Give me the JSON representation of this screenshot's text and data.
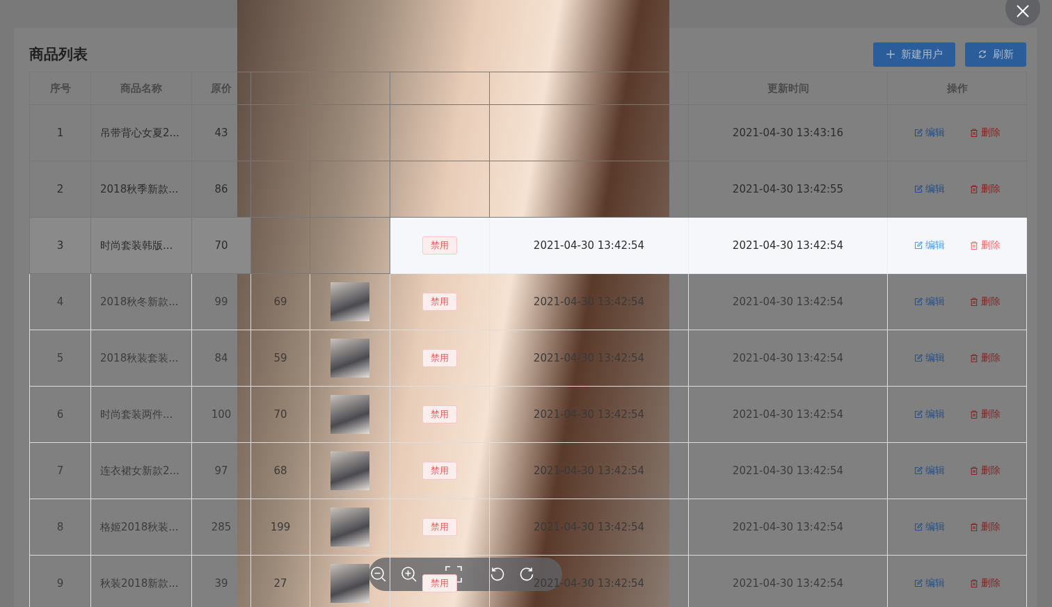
{
  "page": {
    "title": "商品列表",
    "buttons": [
      {
        "kind": "add",
        "label": "新建用户"
      },
      {
        "kind": "refresh",
        "label": "刷新"
      }
    ]
  },
  "table": {
    "columns": [
      "序号",
      "商品名称",
      "原价",
      null,
      null,
      null,
      null,
      "更新时间",
      "操作"
    ],
    "rows": [
      {
        "hovered": false,
        "dimmed": false,
        "index": "1",
        "name": "吊带背心女夏2...",
        "price": "43",
        "current_price": null,
        "thumbnail": false,
        "status": null,
        "created": null,
        "updated": "2021-04-30 13:43:16",
        "actions": [
          {
            "kind": "edit",
            "label": "编辑"
          },
          {
            "kind": "delete",
            "label": "删除"
          }
        ]
      },
      {
        "hovered": false,
        "dimmed": false,
        "index": "2",
        "name": "2018秋季新款...",
        "price": "86",
        "current_price": null,
        "thumbnail": false,
        "status": null,
        "created": null,
        "updated": "2021-04-30 13:42:55",
        "actions": [
          {
            "kind": "edit",
            "label": "编辑"
          },
          {
            "kind": "delete",
            "label": "删除"
          }
        ]
      },
      {
        "hovered": true,
        "dimmed": false,
        "index": "3",
        "name": "时尚套装韩版...",
        "price": "70",
        "current_price": null,
        "thumbnail": false,
        "status": "禁用",
        "created": "2021-04-30 13:42:54",
        "updated": "2021-04-30 13:42:54",
        "actions": [
          {
            "kind": "edit",
            "label": "编辑"
          },
          {
            "kind": "delete",
            "label": "删除"
          }
        ]
      },
      {
        "hovered": false,
        "dimmed": true,
        "index": "4",
        "name": "2018秋冬新款...",
        "price": "99",
        "current_price": "69",
        "thumbnail": true,
        "status": "禁用",
        "created": "2021-04-30 13:42:54",
        "updated": "2021-04-30 13:42:54",
        "actions": [
          {
            "kind": "edit",
            "label": "编辑"
          },
          {
            "kind": "delete",
            "label": "删除"
          }
        ]
      },
      {
        "hovered": false,
        "dimmed": true,
        "index": "5",
        "name": "2018秋装套装...",
        "price": "84",
        "current_price": "59",
        "thumbnail": true,
        "status": "禁用",
        "created": "2021-04-30 13:42:54",
        "updated": "2021-04-30 13:42:54",
        "actions": [
          {
            "kind": "edit",
            "label": "编辑"
          },
          {
            "kind": "delete",
            "label": "删除"
          }
        ]
      },
      {
        "hovered": false,
        "dimmed": true,
        "index": "6",
        "name": "时尚套装两件...",
        "price": "100",
        "current_price": "70",
        "thumbnail": true,
        "status": "禁用",
        "created": "2021-04-30 13:42:54",
        "updated": "2021-04-30 13:42:54",
        "actions": [
          {
            "kind": "edit",
            "label": "编辑"
          },
          {
            "kind": "delete",
            "label": "删除"
          }
        ]
      },
      {
        "hovered": false,
        "dimmed": true,
        "index": "7",
        "name": "连衣裙女新款2...",
        "price": "97",
        "current_price": "68",
        "thumbnail": true,
        "status": "禁用",
        "created": "2021-04-30 13:42:54",
        "updated": "2021-04-30 13:42:54",
        "actions": [
          {
            "kind": "edit",
            "label": "编辑"
          },
          {
            "kind": "delete",
            "label": "删除"
          }
        ]
      },
      {
        "hovered": false,
        "dimmed": true,
        "index": "8",
        "name": "格姬2018秋装...",
        "price": "285",
        "current_price": "199",
        "thumbnail": true,
        "status": "禁用",
        "created": "2021-04-30 13:42:54",
        "updated": "2021-04-30 13:42:54",
        "actions": [
          {
            "kind": "edit",
            "label": "编辑"
          },
          {
            "kind": "delete",
            "label": "删除"
          }
        ]
      },
      {
        "hovered": false,
        "dimmed": true,
        "index": "9",
        "name": "秋装2018新款...",
        "price": "39",
        "current_price": "27",
        "thumbnail": true,
        "status": "禁用",
        "created": "2021-04-30 13:42:54",
        "updated": "2021-04-30 13:42:54",
        "actions": [
          {
            "kind": "edit",
            "label": "编辑"
          },
          {
            "kind": "delete",
            "label": "删除"
          }
        ]
      }
    ]
  },
  "viewer": {
    "toolbar": [
      {
        "kind": "zoom-out"
      },
      {
        "kind": "zoom-in"
      },
      {
        "kind": "fit"
      },
      {
        "kind": "rotate-left"
      },
      {
        "kind": "rotate-right"
      }
    ]
  }
}
